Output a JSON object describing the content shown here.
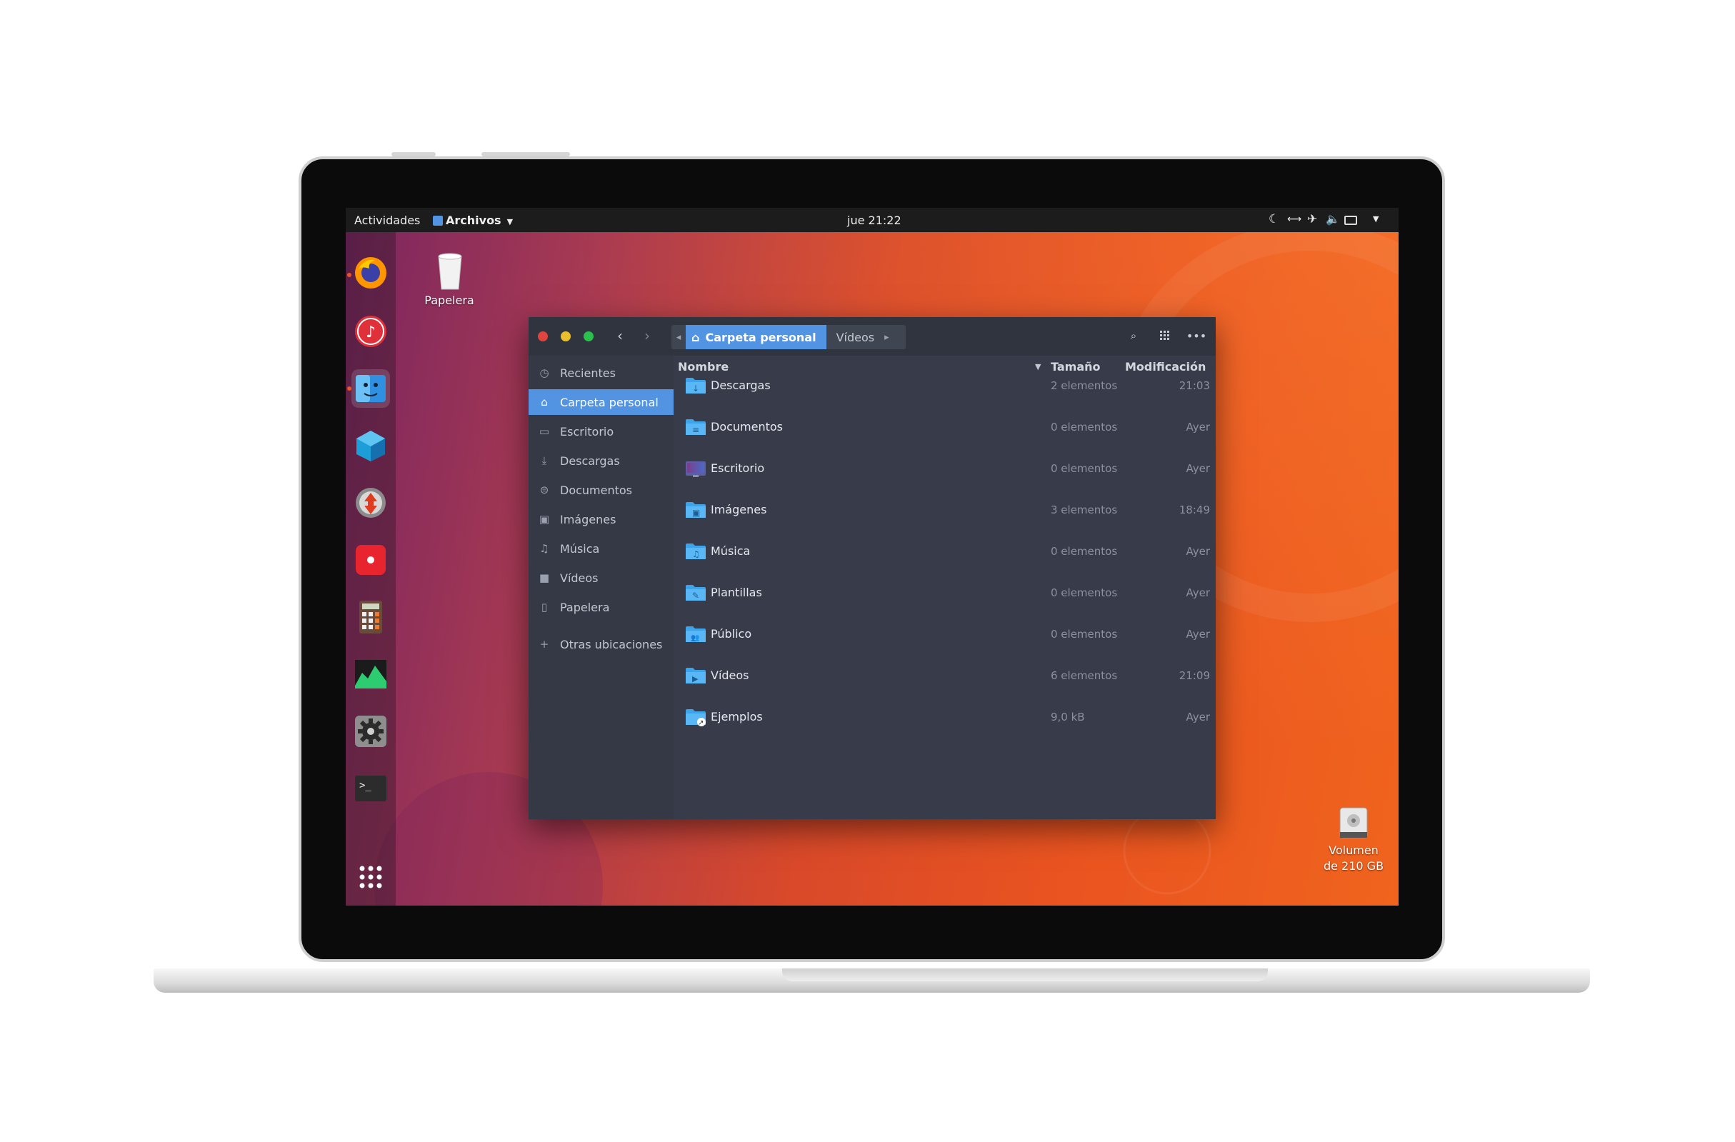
{
  "topbar": {
    "activities": "Actividades",
    "app_menu": "Archivos",
    "clock": "jue 21:22"
  },
  "desktop": {
    "trash_label": "Papelera",
    "volume_label_line1": "Volumen",
    "volume_label_line2": "de 210 GB"
  },
  "dock": {
    "items": [
      "firefox-icon",
      "rhythmbox-icon",
      "files-icon",
      "software-icon",
      "update-icon",
      "screen-recorder-icon",
      "calculator-icon",
      "system-monitor-icon",
      "settings-icon",
      "terminal-icon"
    ],
    "show_apps": "apps-grid-icon"
  },
  "window": {
    "breadcrumb": {
      "current": "Carpeta personal",
      "next": "Vídeos"
    },
    "sidebar": {
      "items": [
        {
          "label": "Recientes",
          "icon": "clock-icon"
        },
        {
          "label": "Carpeta personal",
          "icon": "home-icon",
          "selected": true
        },
        {
          "label": "Escritorio",
          "icon": "desktop-icon"
        },
        {
          "label": "Descargas",
          "icon": "download-icon"
        },
        {
          "label": "Documentos",
          "icon": "document-icon"
        },
        {
          "label": "Imágenes",
          "icon": "image-icon"
        },
        {
          "label": "Música",
          "icon": "music-icon"
        },
        {
          "label": "Vídeos",
          "icon": "video-icon"
        },
        {
          "label": "Papelera",
          "icon": "trash-icon"
        }
      ],
      "other_locations": "Otras ubicaciones"
    },
    "columns": {
      "name": "Nombre",
      "size": "Tamaño",
      "modified": "Modificación"
    },
    "files": [
      {
        "name": "Descargas",
        "size": "2 elementos",
        "modified": "21:03",
        "emblem": "↓"
      },
      {
        "name": "Documentos",
        "size": "0 elementos",
        "modified": "Ayer",
        "emblem": "≡"
      },
      {
        "name": "Escritorio",
        "size": "0 elementos",
        "modified": "Ayer",
        "emblem": ""
      },
      {
        "name": "Imágenes",
        "size": "3 elementos",
        "modified": "18:49",
        "emblem": "▣"
      },
      {
        "name": "Música",
        "size": "0 elementos",
        "modified": "Ayer",
        "emblem": "♫"
      },
      {
        "name": "Plantillas",
        "size": "0 elementos",
        "modified": "Ayer",
        "emblem": "✎"
      },
      {
        "name": "Público",
        "size": "0 elementos",
        "modified": "Ayer",
        "emblem": "👥"
      },
      {
        "name": "Vídeos",
        "size": "6 elementos",
        "modified": "21:09",
        "emblem": "▶"
      },
      {
        "name": "Ejemplos",
        "size": "9,0 kB",
        "modified": "Ayer",
        "emblem": "↗"
      }
    ]
  },
  "colors": {
    "accent": "#5294e2",
    "ubuntu_orange": "#e95420",
    "window_bg": "#383c4a",
    "header_bg": "#2f343f"
  }
}
